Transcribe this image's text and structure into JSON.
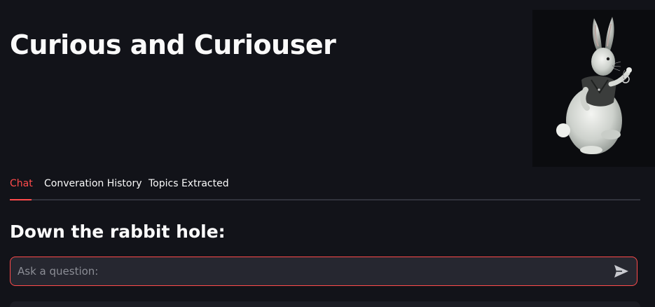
{
  "header": {
    "title": "Curious and Curiouser",
    "image_icon": "white-rabbit-with-pocket-watch"
  },
  "tabs": [
    {
      "label": "Chat",
      "active": true
    },
    {
      "label": "Converation History",
      "active": false
    },
    {
      "label": "Topics Extracted",
      "active": false
    }
  ],
  "main": {
    "heading": "Down the rabbit hole:",
    "chat_input": {
      "placeholder": "Ask a question:",
      "value": "",
      "send_icon": "paper-plane-icon"
    }
  },
  "colors": {
    "background": "#121319",
    "accent": "#ff4b4b",
    "input_background": "#262730",
    "text": "#fafafa",
    "placeholder": "#8b8d95"
  }
}
